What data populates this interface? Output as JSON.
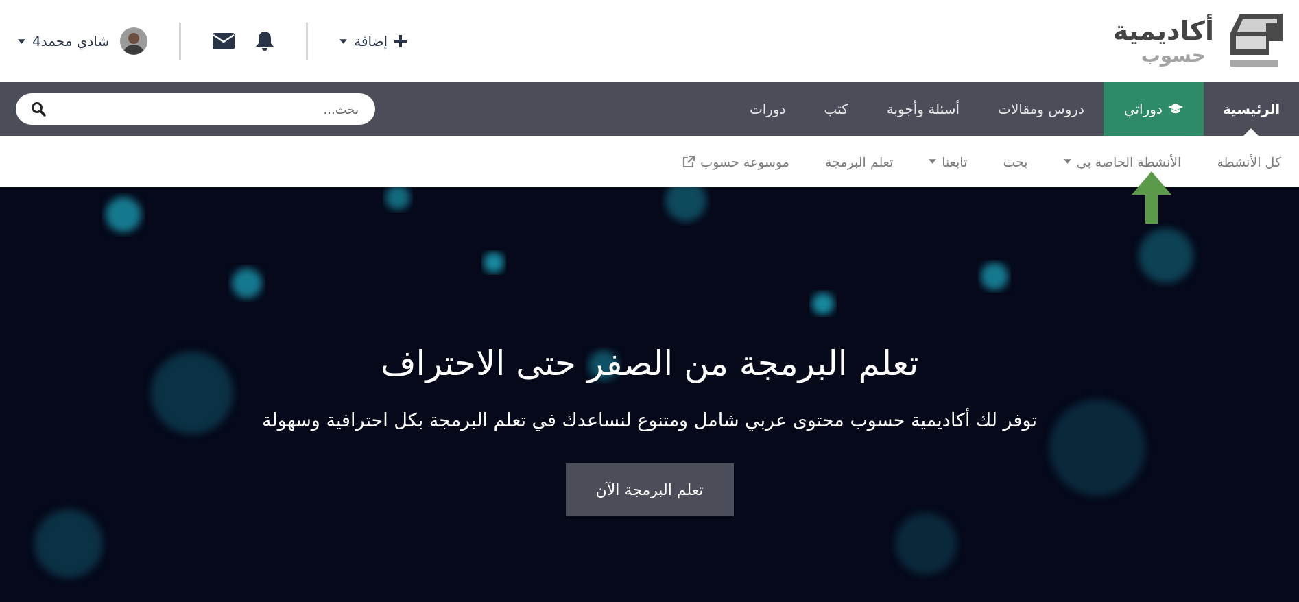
{
  "logo": {
    "line_1": "أكاديمية",
    "line_2": "حسوب"
  },
  "header_actions": {
    "add": "إضافة",
    "user_name": "شادي محمد4"
  },
  "nav": {
    "items": [
      {
        "label": "الرئيسية",
        "selected": true,
        "kind": "plain"
      },
      {
        "label": "دوراتي",
        "selected": false,
        "kind": "featured"
      },
      {
        "label": "دروس ومقالات",
        "selected": false,
        "kind": "plain"
      },
      {
        "label": "أسئلة وأجوبة",
        "selected": false,
        "kind": "plain"
      },
      {
        "label": "كتب",
        "selected": false,
        "kind": "plain"
      },
      {
        "label": "دورات",
        "selected": false,
        "kind": "plain"
      }
    ],
    "search": {
      "placeholder": "بحث..."
    }
  },
  "subnav": [
    {
      "label": "كل الأنشطة",
      "kind": "plain"
    },
    {
      "label": "الأنشطة الخاصة بي",
      "kind": "dropdown"
    },
    {
      "label": "بحث",
      "kind": "plain"
    },
    {
      "label": "تابعنا",
      "kind": "dropdown"
    },
    {
      "label": "تعلم البرمجة",
      "kind": "plain"
    },
    {
      "label": "موسوعة حسوب",
      "kind": "external"
    }
  ],
  "hero": {
    "kind": "picture",
    "title": "تعلم البرمجة من الصفر حتى الاحتراف",
    "subtitle": "توفر لك أكاديمية حسوب محتوى عربي شامل ومتنوع لنساعدك في تعلم البرمجة بكل احترافية وسهولة",
    "button": "تعلم البرمجة الآن"
  }
}
